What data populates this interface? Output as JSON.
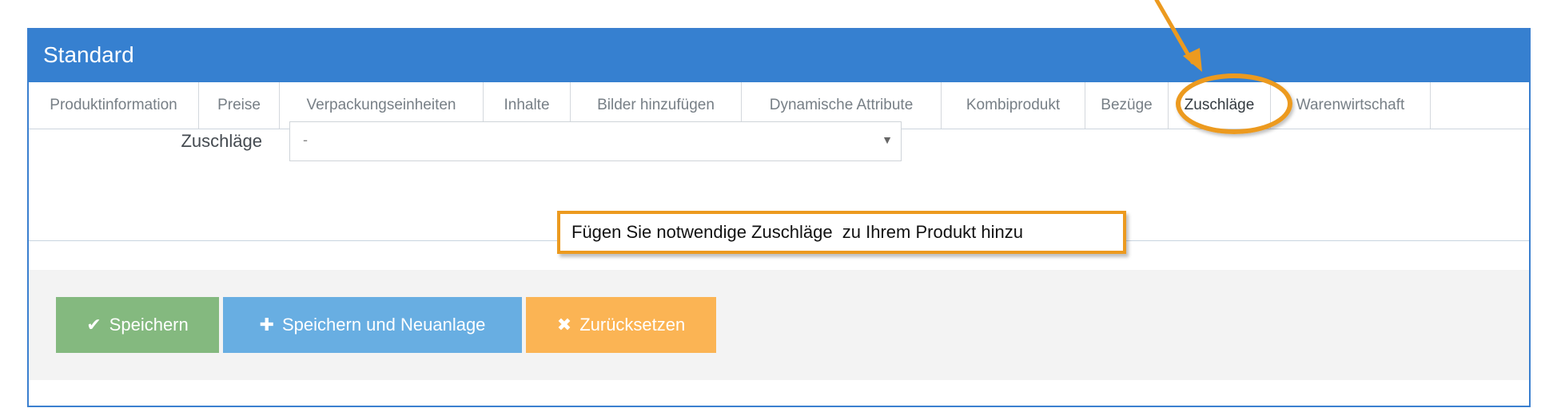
{
  "panel": {
    "title": "Standard"
  },
  "tabs": [
    {
      "label": "Produktinformation"
    },
    {
      "label": "Preise"
    },
    {
      "label": "Verpackungseinheiten"
    },
    {
      "label": "Inhalte"
    },
    {
      "label": "Bilder hinzufügen"
    },
    {
      "label": "Dynamische Attribute"
    },
    {
      "label": "Kombiprodukt"
    },
    {
      "label": "Bezüge"
    },
    {
      "label": "Zuschläge"
    },
    {
      "label": "Warenwirtschaft"
    }
  ],
  "active_tab": "Zuschläge",
  "form": {
    "surcharge_label": "Zuschläge",
    "surcharge_value": "-",
    "dropdown_arrow": "▼"
  },
  "actions": {
    "save_icon": "✔",
    "save_label": "Speichern",
    "save_new_icon": "✚",
    "save_new_label": "Speichern und Neuanlage",
    "reset_icon": "✖",
    "reset_label": "Zurücksetzen"
  },
  "annotation": {
    "callout_text": "Fügen Sie notwendige Zuschläge  zu Ihrem Produkt hinzu",
    "color": "#ec9a1f"
  },
  "colors": {
    "header": "#3680d0",
    "save": "#84b97f",
    "save_new": "#68aee2",
    "reset": "#fbb454"
  }
}
